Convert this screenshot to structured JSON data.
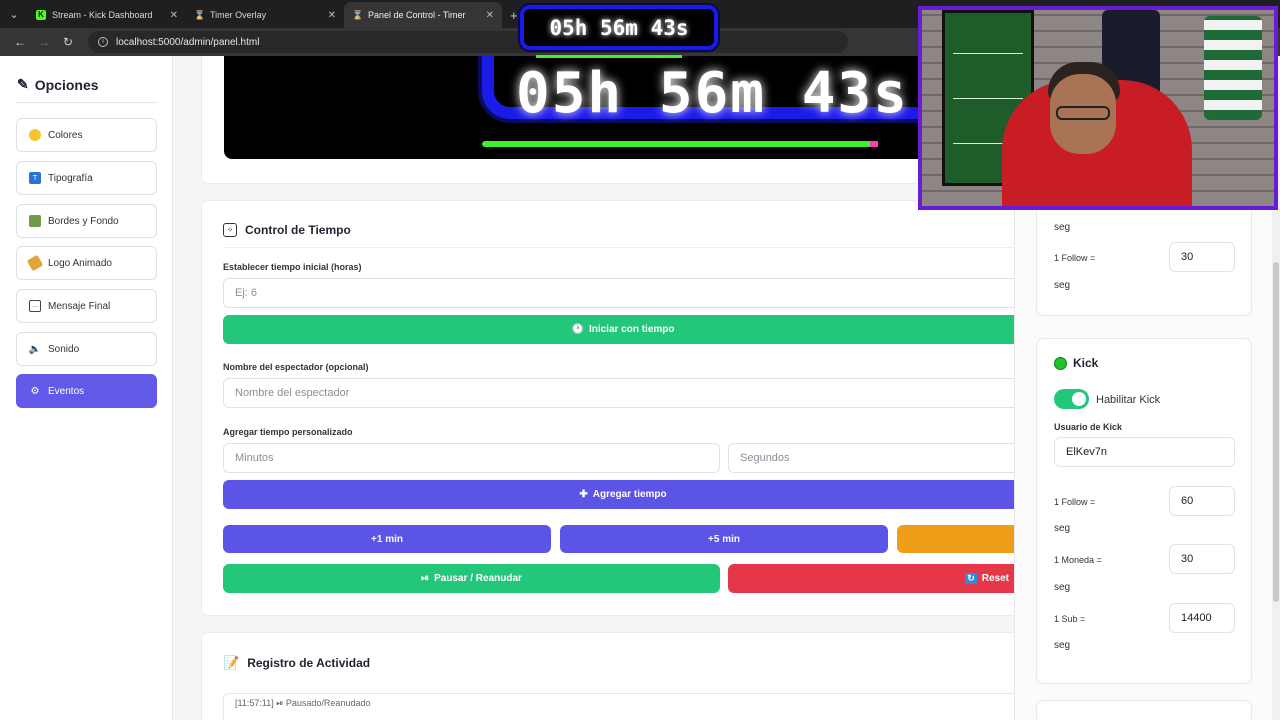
{
  "browser": {
    "tabs": [
      {
        "title": "Stream - Kick Dashboard",
        "icon": "kick-icon",
        "active": false
      },
      {
        "title": "Timer Overlay",
        "icon": "timer-icon",
        "active": false
      },
      {
        "title": "Panel de Control - Timer",
        "icon": "timer-icon",
        "active": true
      }
    ],
    "new_tab": "+",
    "url": "localhost:5000/admin/panel.html"
  },
  "sidebar": {
    "title": "Opciones",
    "items": [
      {
        "label": "Colores",
        "icon": "palette-icon"
      },
      {
        "label": "Tipografía",
        "icon": "typography-icon"
      },
      {
        "label": "Bordes y Fondo",
        "icon": "image-icon"
      },
      {
        "label": "Logo Animado",
        "icon": "tag-icon"
      },
      {
        "label": "Mensaje Final",
        "icon": "chat-icon"
      },
      {
        "label": "Sonido",
        "icon": "speaker-icon"
      },
      {
        "label": "Eventos",
        "icon": "gear-icon",
        "active": true
      }
    ]
  },
  "preview": {
    "time": "05h 56m 43s"
  },
  "control": {
    "title": "Control de Tiempo",
    "initial_label": "Establecer tiempo inicial (horas)",
    "initial_placeholder": "Ej: 6",
    "start_button": "Iniciar con tiempo",
    "viewer_label": "Nombre del espectador (opcional)",
    "viewer_placeholder": "Nombre del espectador",
    "custom_label": "Agregar tiempo personalizado",
    "minutes_placeholder": "Minutos",
    "seconds_placeholder": "Segundos",
    "add_button": "Agregar tiempo",
    "plus1": "+1 min",
    "plus5": "+5 min",
    "pause_button": "Pausar / Reanudar",
    "reset_button": "Reset"
  },
  "log": {
    "title": "Registro de Actividad",
    "entries": [
      "[11:57:11] ⏯ Pausado/Reanudado"
    ]
  },
  "right_panel": {
    "top_card": {
      "seg_a": "seg",
      "follow_label": "1 Follow =",
      "follow_value": "30",
      "seg_b": "seg"
    },
    "kick": {
      "title": "Kick",
      "enable_label": "Habilitar Kick",
      "enabled": true,
      "user_label": "Usuario de Kick",
      "user_value": "ElKev7n",
      "follow_label": "1 Follow =",
      "follow_value": "60",
      "follow_unit": "seg",
      "coin_label": "1 Moneda =",
      "coin_value": "30",
      "coin_unit": "seg",
      "sub_label": "1 Sub =",
      "sub_value": "14400",
      "sub_unit": "seg"
    }
  },
  "overlay": {
    "time": "05h 56m 43s"
  },
  "colors": {
    "accent": "#5b54e6",
    "success": "#22c77a",
    "danger": "#e5364a",
    "warning": "#f09d1a",
    "overlay_border": "#1b1be8",
    "progress": "#3cf22e"
  }
}
